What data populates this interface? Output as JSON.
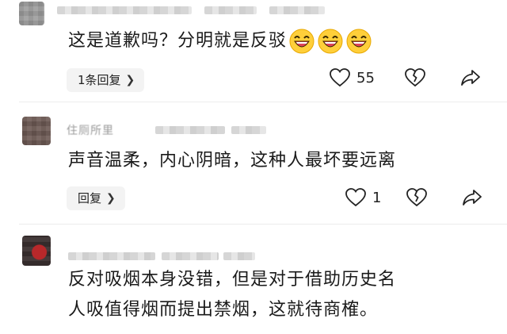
{
  "comments": [
    {
      "text": "这是道歉吗？分明就是反驳",
      "emojis": [
        "laughing-emoji",
        "laughing-emoji",
        "laughing-emoji"
      ],
      "reply_label": "1条回复",
      "likes": "55",
      "icons": [
        "heart-icon",
        "broken-heart-icon",
        "share-icon"
      ]
    },
    {
      "username": "住厕所里",
      "text": "声音温柔，内心阴暗，这种人最坏要远离",
      "reply_label": "回复",
      "likes": "1",
      "icons": [
        "heart-icon",
        "broken-heart-icon",
        "share-icon"
      ]
    },
    {
      "lines": [
        "反对吸烟本身没错，但是对于借助历史名",
        "人吸值得烟而提出禁烟，这就待商榷。"
      ]
    }
  ],
  "colors": {
    "emoji_face": "#ffcf3a",
    "emoji_mouth": "#e0445a",
    "reply_bg": "#f3f3f3"
  }
}
